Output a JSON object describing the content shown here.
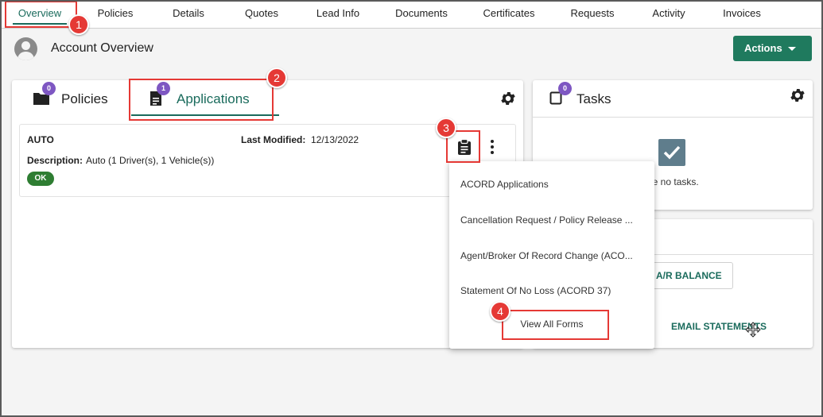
{
  "nav": {
    "tabs": [
      {
        "label": "Overview"
      },
      {
        "label": "Policies"
      },
      {
        "label": "Details"
      },
      {
        "label": "Quotes"
      },
      {
        "label": "Lead Info"
      },
      {
        "label": "Documents"
      },
      {
        "label": "Certificates"
      },
      {
        "label": "Requests"
      },
      {
        "label": "Activity"
      },
      {
        "label": "Invoices"
      }
    ],
    "active": "Overview"
  },
  "header": {
    "title": "Account Overview",
    "actions_label": "Actions"
  },
  "policies_card": {
    "tabs": [
      {
        "label": "Policies",
        "badge": "0",
        "icon": "folder-icon"
      },
      {
        "label": "Applications",
        "badge": "1",
        "icon": "document-icon"
      }
    ],
    "active_tab": "Applications",
    "application": {
      "type": "AUTO",
      "last_modified_label": "Last Modified:",
      "last_modified_value": "12/13/2022",
      "description_label": "Description:",
      "description_value": "Auto (1 Driver(s), 1 Vehicle(s))",
      "status": "OK"
    }
  },
  "tasks_card": {
    "title": "Tasks",
    "badge": "0",
    "empty_text": "are no tasks."
  },
  "ar_card": {
    "ar_balance_label": "A/R BALANCE",
    "email_statements_label": "EMAIL STATEMENTS"
  },
  "dropdown": {
    "items": [
      "ACORD Applications",
      "Cancellation Request / Policy Release ...",
      "Agent/Broker Of Record Change (ACO...",
      "Statement Of No Loss (ACORD 37)"
    ],
    "view_all": "View All Forms"
  },
  "annotations": {
    "markers": [
      "1",
      "2",
      "3",
      "4"
    ],
    "color": "#e53935"
  },
  "colors": {
    "accent": "#1a6b5c",
    "actions_button": "#1f7a5e",
    "badge": "#7e57c2",
    "status_ok": "#2e7d32"
  }
}
